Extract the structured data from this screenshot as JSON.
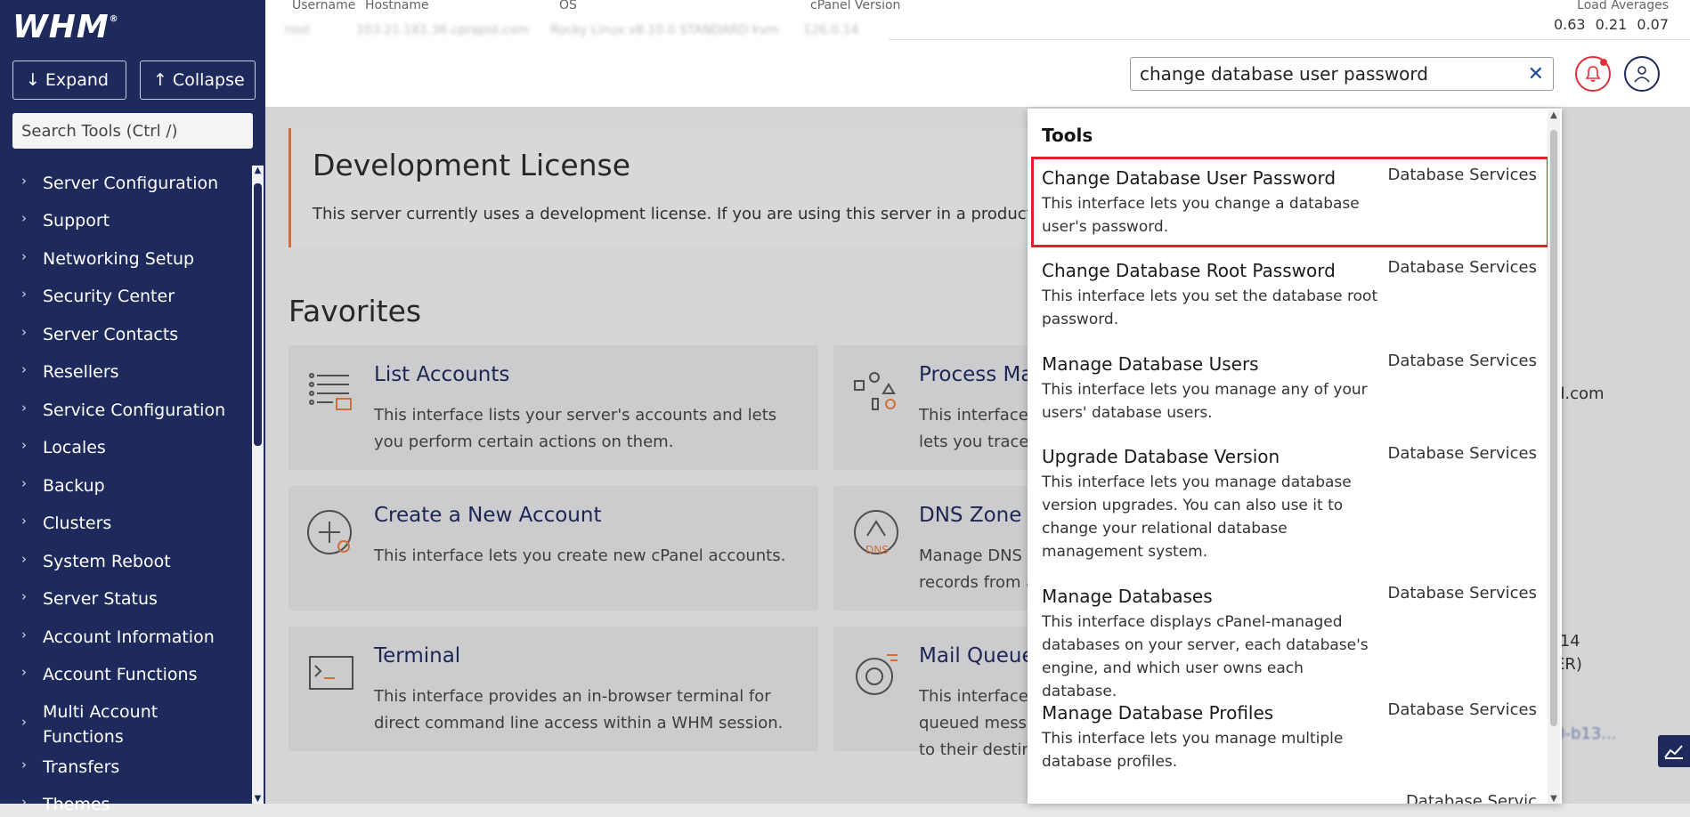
{
  "sidebar": {
    "logo": "WHM",
    "expand_label": "Expand",
    "collapse_label": "Collapse",
    "search_placeholder": "Search Tools (Ctrl /)",
    "items": [
      {
        "label": "Server Configuration"
      },
      {
        "label": "Support"
      },
      {
        "label": "Networking Setup"
      },
      {
        "label": "Security Center"
      },
      {
        "label": "Server Contacts"
      },
      {
        "label": "Resellers"
      },
      {
        "label": "Service Configuration"
      },
      {
        "label": "Locales"
      },
      {
        "label": "Backup"
      },
      {
        "label": "Clusters"
      },
      {
        "label": "System Reboot"
      },
      {
        "label": "Server Status"
      },
      {
        "label": "Account Information"
      },
      {
        "label": "Account Functions"
      },
      {
        "label": "Multi Account Functions"
      },
      {
        "label": "Transfers"
      },
      {
        "label": "Themes"
      }
    ]
  },
  "header": {
    "username_label": "Username",
    "username_value": "root",
    "hostname_label": "Hostname",
    "hostname_value": "103.21.181.36.cprapid.com",
    "os_label": "OS",
    "os_value": "Rocky Linux v8.10.0 STANDARD kvm",
    "cpanel_label": "cPanel Version",
    "cpanel_value": "126.0.14",
    "load_label": "Load Averages",
    "load_values": "0.63 0.21 0.07",
    "search_value": "change database user password"
  },
  "main": {
    "license_title": "Development License",
    "license_text": "This server currently uses a development license. If you are using this server in a production enviro",
    "favorites_title": "Favorites",
    "cards": [
      {
        "title": "List Accounts",
        "desc": "This interface lists your server's accounts and lets you perform certain actions on them."
      },
      {
        "title": "Process Man",
        "desc": "This interface d\nlets you trace a"
      },
      {
        "title": "Create a New Account",
        "desc": "This interface lets you create new cPanel accounts."
      },
      {
        "title": "DNS Zone M",
        "desc": "Manage DNS zo\nrecords from a"
      },
      {
        "title": "Terminal",
        "desc": "This interface provides an in-browser terminal for direct command line access within a WHM session."
      },
      {
        "title": "Mail Queue",
        "desc": "This interface l\nqueued messag\nto their destina"
      }
    ],
    "right_fragments": [
      "d.com",
      ".14",
      "ER)",
      "0-b13..."
    ]
  },
  "dropdown": {
    "heading": "Tools",
    "items": [
      {
        "name": "Change Database User Password",
        "desc": "This interface lets you change a database user's password.",
        "category": "Database Services",
        "selected": true
      },
      {
        "name": "Change Database Root Password",
        "desc": "This interface lets you set the database root password.",
        "category": "Database Services"
      },
      {
        "name": "Manage Database Users",
        "desc": "This interface lets you manage any of your users' database users.",
        "category": "Database Services"
      },
      {
        "name": "Upgrade Database Version",
        "desc": "This interface lets you manage database version upgrades. You can also use it to change your relational database management system.",
        "category": "Database Services"
      },
      {
        "name": "Manage Databases",
        "desc": "This interface displays cPanel-managed databases on your server, each database's engine, and which user owns each database.",
        "category": "Database Services"
      },
      {
        "name": "Manage Database Profiles",
        "desc": "This interface lets you manage multiple database profiles.",
        "category": "Database Services"
      },
      {
        "name": "",
        "desc": "",
        "category": "Database Servic"
      }
    ]
  },
  "colors": {
    "sidebar_bg": "#1f2a5c",
    "accent_orange": "#e07a3c",
    "selection_red": "#e0202a"
  }
}
